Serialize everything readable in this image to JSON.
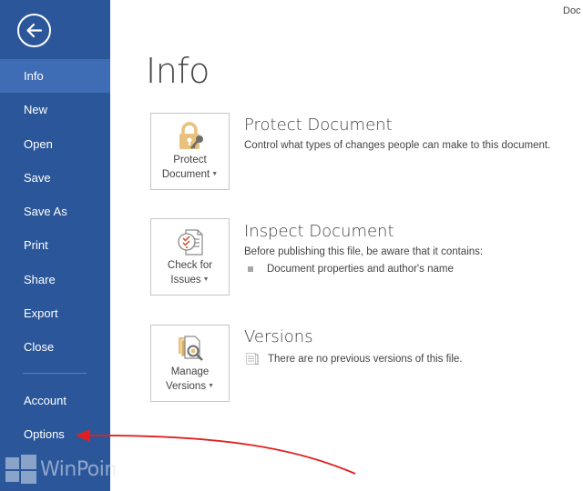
{
  "window": {
    "title": "Doc"
  },
  "sidebar": {
    "back_icon": "back-arrow-icon",
    "items": [
      {
        "label": "Info",
        "active": true
      },
      {
        "label": "New"
      },
      {
        "label": "Open"
      },
      {
        "label": "Save"
      },
      {
        "label": "Save As"
      },
      {
        "label": "Print"
      },
      {
        "label": "Share"
      },
      {
        "label": "Export"
      },
      {
        "label": "Close"
      }
    ],
    "bottom_items": [
      {
        "label": "Account"
      },
      {
        "label": "Options"
      }
    ],
    "color": "#2b579a",
    "active_color": "#3e6db5"
  },
  "watermark": {
    "text": "WinPoin"
  },
  "main": {
    "title": "Info",
    "sections": [
      {
        "button_line1": "Protect",
        "button_line2": "Document",
        "icon": "lock-key-icon",
        "title": "Protect Document",
        "description": "Control what types of changes people can make to this document."
      },
      {
        "button_line1": "Check for",
        "button_line2": "Issues",
        "icon": "inspect-document-icon",
        "title": "Inspect Document",
        "description": "Before publishing this file, be aware that it contains:",
        "bullets": [
          "Document properties and author's name"
        ]
      },
      {
        "button_line1": "Manage",
        "button_line2": "Versions",
        "icon": "manage-versions-icon",
        "title": "Versions",
        "description": "There are no previous versions of this file."
      }
    ]
  },
  "annotation": {
    "arrow_color": "#e02020"
  }
}
